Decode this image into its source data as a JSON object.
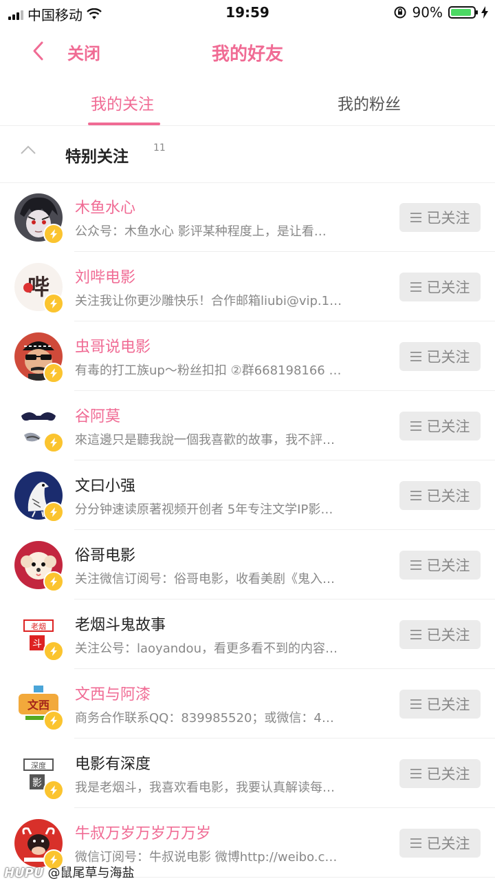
{
  "status_bar": {
    "carrier": "中国移动",
    "time": "19:59",
    "battery_percent": "90%",
    "battery_level": 0.9
  },
  "nav": {
    "close_label": "关闭",
    "title": "我的好友"
  },
  "tabs": [
    {
      "label": "我的关注",
      "active": true
    },
    {
      "label": "我的粉丝",
      "active": false
    }
  ],
  "group": {
    "name": "特别关注",
    "count": "11"
  },
  "users": [
    {
      "name": "木鱼水心",
      "highlight": true,
      "desc": "公众号：木鱼水心 影评某种程度上，是让看…",
      "button": "已关注",
      "avatar": "anime-boy"
    },
    {
      "name": "刘哔电影",
      "highlight": true,
      "desc": "关注我让你更沙雕快乐！合作邮箱liubi@vip.1…",
      "button": "已关注",
      "avatar": "bi-logo"
    },
    {
      "name": "虫哥说电影",
      "highlight": true,
      "desc": "有毒的打工族up～粉丝扣扣 ②群668198166 …",
      "button": "已关注",
      "avatar": "sunglasses"
    },
    {
      "name": "谷阿莫",
      "highlight": true,
      "desc": "來這邊只是聽我說一個我喜歡的故事，我不評…",
      "button": "已关注",
      "avatar": "mustache"
    },
    {
      "name": "文曰小强",
      "highlight": false,
      "desc": "分分钟速读原著视频开创者 5年专注文学IP影…",
      "button": "已关注",
      "avatar": "pigeon"
    },
    {
      "name": "俗哥电影",
      "highlight": false,
      "desc": "关注微信订阅号：俗哥电影，收看美剧《鬼入…",
      "button": "已关注",
      "avatar": "puppy"
    },
    {
      "name": "老烟斗鬼故事",
      "highlight": false,
      "desc": "关注公号：laoyandou，看更多看不到的内容…",
      "button": "已关注",
      "avatar": "red-seal"
    },
    {
      "name": "文西与阿漆",
      "highlight": true,
      "desc": "商务合作联系QQ：839985520；或微信：4…",
      "button": "已关注",
      "avatar": "colorful-logo"
    },
    {
      "name": "电影有深度",
      "highlight": false,
      "desc": "我是老烟斗，我喜欢看电影，我要认真解读每…",
      "button": "已关注",
      "avatar": "grey-seal"
    },
    {
      "name": "牛叔万岁万岁万万岁",
      "highlight": true,
      "desc": "微信订阅号：牛叔说电影 微博http://weibo.c…",
      "button": "已关注",
      "avatar": "bull"
    }
  ],
  "watermark": {
    "brand": "HUPU",
    "text": "@鼠尾草与海盐"
  },
  "colors": {
    "accent": "#f06b94",
    "badge": "#fbc42f",
    "button_bg": "#ebebeb"
  }
}
